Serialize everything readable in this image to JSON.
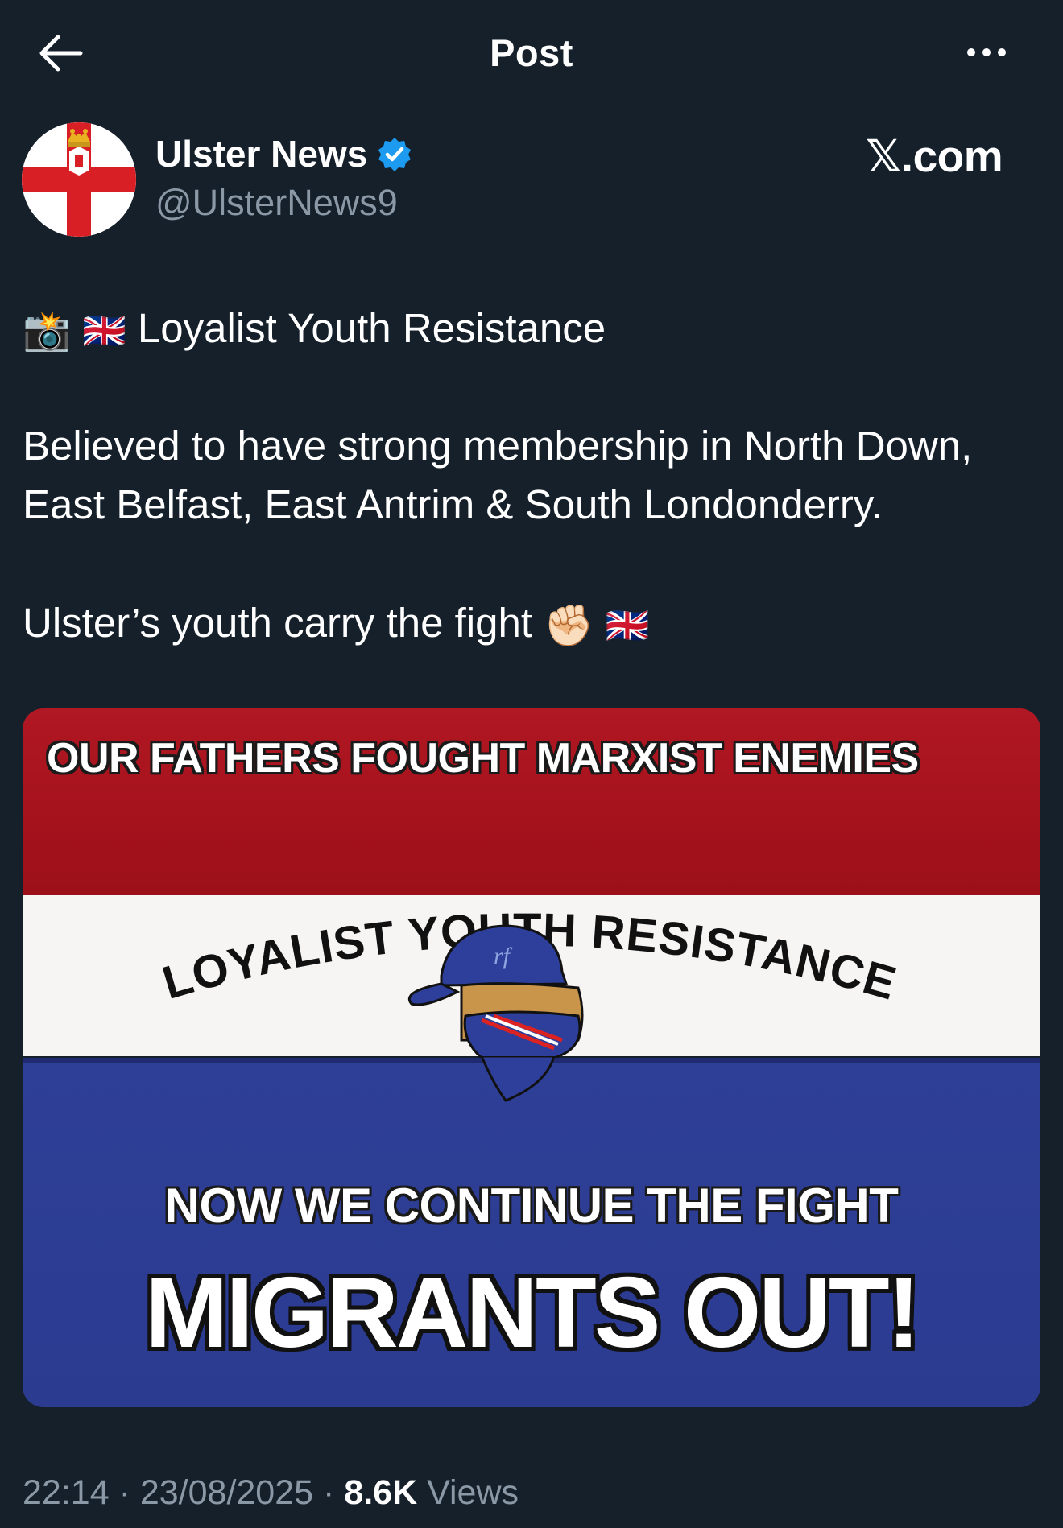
{
  "header": {
    "title": "Post",
    "back_icon": "arrow-left-icon",
    "more_icon": "more-horizontal-icon"
  },
  "author": {
    "name": "Ulster News",
    "handle": "@UlsterNews9",
    "verified": true,
    "verified_color": "#1d9bf0"
  },
  "watermark": "𝕏.com",
  "post": {
    "line1_emoji": "📸",
    "line1_flag": "🇬🇧",
    "line1_text": "Loyalist Youth Resistance",
    "paragraph2_line1": "Believed to have strong membership in North Down,",
    "paragraph2_line2": "East Belfast, East Antrim & South Londonderry.",
    "paragraph3_text": "Ulster’s youth carry the fight",
    "paragraph3_emoji": "✊🏻",
    "paragraph3_flag": "🇬🇧"
  },
  "image": {
    "top_text": "OUR FATHERS FOUGHT MARXIST ENEMIES",
    "arc_text": "LOYALIST YOUTH RESISTANCE",
    "middle_text": "NOW WE CONTINUE THE FIGHT",
    "bottom_text": "MIGRANTS OUT!",
    "colors": {
      "red": "#a5121c",
      "white": "#f7f5f4",
      "blue": "#2e3f97"
    }
  },
  "meta": {
    "time": "22:14",
    "date": "23/08/2025",
    "views_count": "8.6K",
    "views_label": "Views"
  }
}
